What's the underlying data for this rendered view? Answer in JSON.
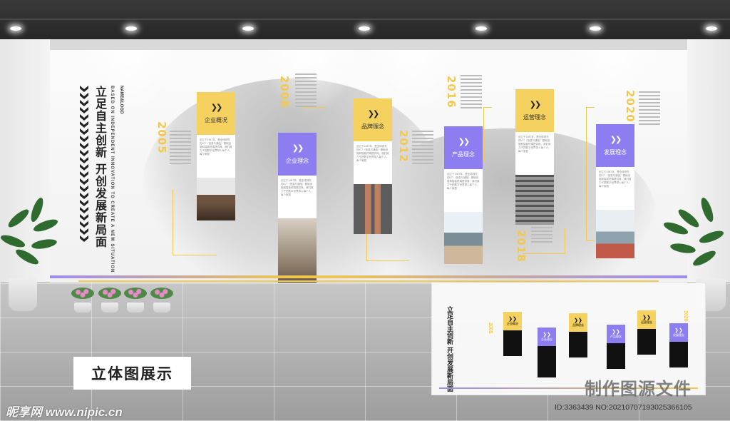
{
  "wall": {
    "title": "立足自主创新 开创发展新局面",
    "subtitle_en": "BASED ON INDEPENDENT INNOVATION TO CREATE A NEW SITUATION",
    "logo": "NAME&LOGO"
  },
  "years": [
    "2005",
    "2008",
    "2012",
    "2016",
    "2018",
    "2020"
  ],
  "cards": [
    {
      "label": "企业概况",
      "color": "#f5d25f",
      "icon": "double-chevron-right-icon"
    },
    {
      "label": "企业理念",
      "color": "#8c7ef0",
      "icon": "double-chevron-right-icon"
    },
    {
      "label": "品牌理念",
      "color": "#f5d25f",
      "icon": "double-chevron-right-icon"
    },
    {
      "label": "产品理念",
      "color": "#8c7ef0",
      "icon": "double-chevron-right-icon"
    },
    {
      "label": "运营理念",
      "color": "#f5d25f",
      "icon": "double-chevron-right-icon"
    },
    {
      "label": "发展理念",
      "color": "#8c7ef0",
      "icon": "double-chevron-right-icon"
    }
  ],
  "card_text": "创立于1987年，是全球领先的ICT（信息与通信）基础设施和智能终端提供商，我们致力于把数字世界带入每个人、每个家庭",
  "caption": "立体图展示",
  "watermarks": {
    "right": "制作图源文件",
    "left": "昵享网 www.nipic.cn",
    "id": "ID:3363439 NO:20210707193025366105"
  },
  "colors": {
    "accent_yellow": "#f2c94c",
    "accent_purple": "#8c7ef0"
  }
}
